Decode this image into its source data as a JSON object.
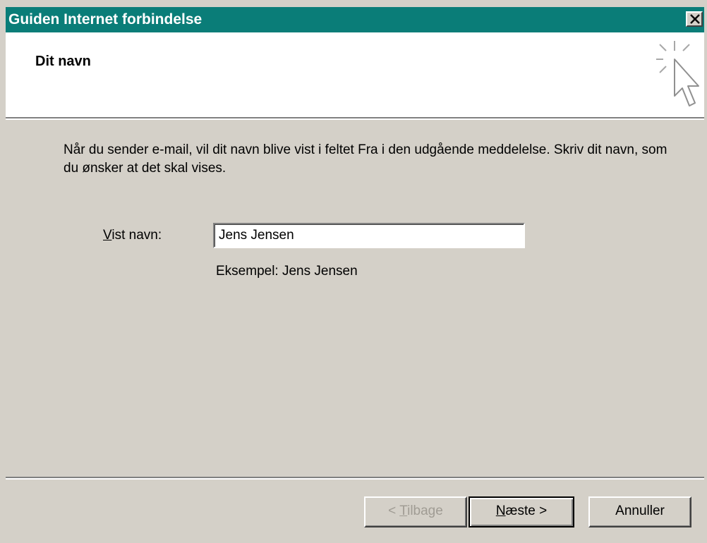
{
  "window": {
    "title": "Guiden Internet forbindelse",
    "close_icon": "close-icon"
  },
  "header": {
    "title": "Dit navn",
    "icon": "cursor-click-icon"
  },
  "content": {
    "intro": "Når du sender e-mail, vil dit navn blive vist i feltet Fra i den udgående meddelelse. Skriv dit navn, som du ønsker at det skal vises.",
    "name_label_accel": "V",
    "name_label_rest": "ist navn:",
    "name_value": "Jens Jensen",
    "example": "Eksempel: Jens Jensen"
  },
  "buttons": {
    "back_prefix": "< ",
    "back_accel": "T",
    "back_rest": "ilbage",
    "next_accel": "N",
    "next_rest": "æste >",
    "cancel": "Annuller"
  },
  "colors": {
    "titlebar": "#0a7d78",
    "dialog_bg": "#d4d0c8",
    "header_bg": "#ffffff",
    "disabled_text": "#a09c94"
  }
}
